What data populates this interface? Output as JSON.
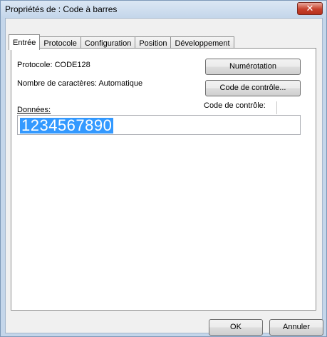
{
  "window": {
    "title": "Propriétés de : Code à barres"
  },
  "tabs": [
    {
      "label": "Entrée"
    },
    {
      "label": "Protocole"
    },
    {
      "label": "Configuration"
    },
    {
      "label": "Position"
    },
    {
      "label": "Développement"
    }
  ],
  "entry": {
    "protocol_label": "Protocole: CODE128",
    "char_count_label": "Nombre de caractères: Automatique",
    "numbering_button": "Numérotation",
    "check_code_button": "Code de contrôle...",
    "data_label": "Données:",
    "check_code_label": "Code de contrôle:",
    "data_value": "1234567890"
  },
  "footer": {
    "ok_button": "OK",
    "cancel_button": "Annuler"
  },
  "colors": {
    "selection": "#3399ff",
    "close_button": "#c7402b",
    "frame": "#c4d6ea"
  }
}
